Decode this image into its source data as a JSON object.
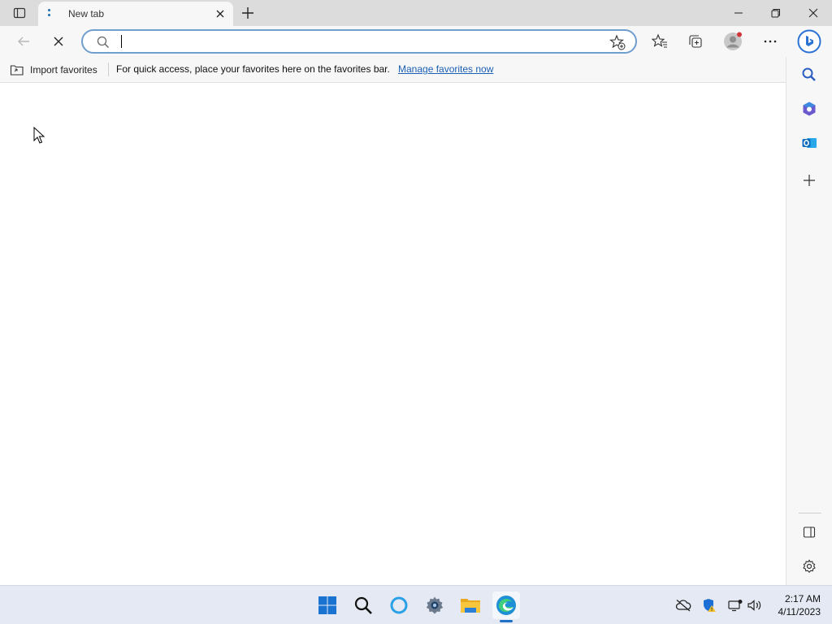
{
  "tab": {
    "title": "New tab"
  },
  "omnibox": {
    "value": "",
    "placeholder": ""
  },
  "favorites_bar": {
    "import_label": "Import favorites",
    "message": "For quick access, place your favorites here on the favorites bar.",
    "manage_link": "Manage favorites now"
  },
  "taskbar": {
    "time": "2:17 AM",
    "date": "4/11/2023"
  },
  "icons": {
    "tab_actions": "tab-actions-icon",
    "close_tab": "close-icon",
    "new_tab": "plus-icon",
    "minimize": "minimize-icon",
    "restore": "restore-icon",
    "close_window": "close-icon",
    "back": "back-arrow-icon",
    "stop": "stop-icon",
    "search": "search-icon",
    "add_favorite": "star-plus-icon",
    "favorites": "favorites-icon",
    "collections": "collections-icon",
    "profile": "profile-icon",
    "more": "more-icon",
    "bing": "bing-icon"
  },
  "colors": {
    "accent": "#1a5fb4",
    "omnibox_border": "#6f9ecf",
    "taskbar_bg": "#e4e9f3",
    "notification_dot": "#d13438"
  }
}
